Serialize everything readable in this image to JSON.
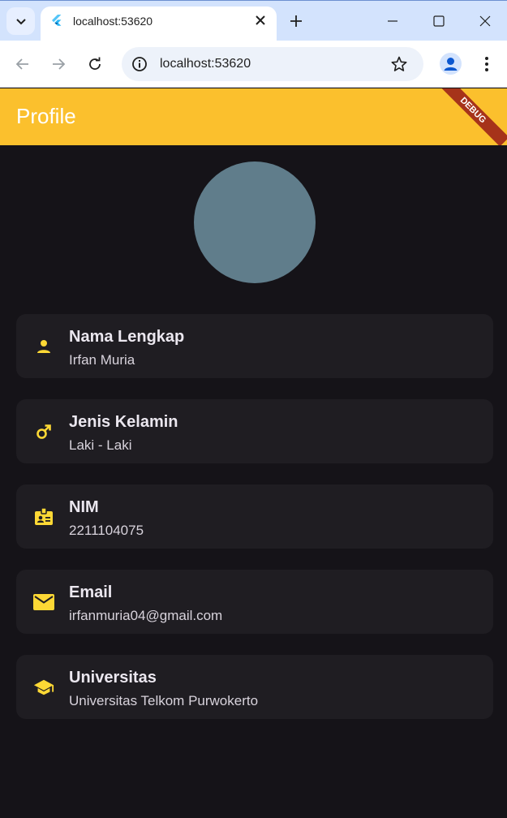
{
  "browser": {
    "tab_title": "localhost:53620",
    "url": "localhost:53620",
    "favicon": "flutter-icon"
  },
  "app": {
    "title": "Profile",
    "debug_label": "DEBUG",
    "colors": {
      "appbar": "#fbc02d",
      "background": "#151318",
      "card": "#1f1d22",
      "icon": "#fdd835",
      "avatar": "#607d8b"
    }
  },
  "profile": {
    "items": [
      {
        "icon": "person-icon",
        "title": "Nama Lengkap",
        "value": "Irfan Muria"
      },
      {
        "icon": "male-icon",
        "title": "Jenis Kelamin",
        "value": "Laki - Laki"
      },
      {
        "icon": "badge-icon",
        "title": "NIM",
        "value": "2211104075"
      },
      {
        "icon": "email-icon",
        "title": "Email",
        "value": "irfanmuria04@gmail.com"
      },
      {
        "icon": "school-icon",
        "title": "Universitas",
        "value": "Universitas Telkom Purwokerto"
      }
    ]
  }
}
